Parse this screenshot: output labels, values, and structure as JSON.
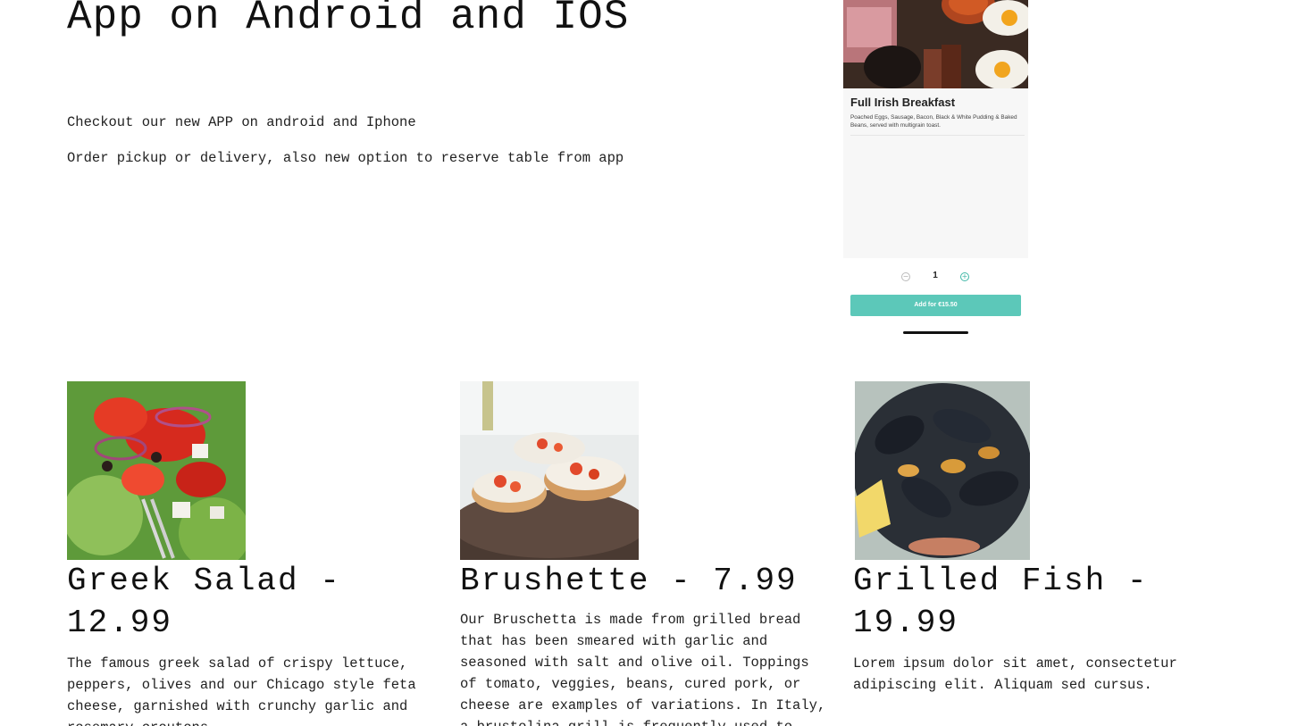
{
  "hero": {
    "title": "App on Android and IOS",
    "line1": "Checkout our new APP on android and Iphone",
    "line2": "Order pickup or delivery, also new option to reserve table from app"
  },
  "phone_app": {
    "item_title": "Full Irish Breakfast",
    "item_description": "Poached Eggs, Sausage, Bacon, Black & White Pudding & Baked Beans, served with multigrain toast.",
    "quantity": "1",
    "minus_symbol": "−",
    "plus_symbol": "+",
    "add_button_label": "Add for €15.50",
    "accent_color": "#5cc8b9"
  },
  "menu": [
    {
      "title": "Greek Salad - 12.99",
      "description": "The famous greek salad of crispy lettuce, peppers, olives and our Chicago style feta cheese, garnished with crunchy garlic and rosemary croutons.",
      "image": "greek-salad-photo"
    },
    {
      "title": "Brushette - 7.99",
      "description": "Our Bruschetta is made from grilled bread that has been smeared with garlic and seasoned with salt and olive oil. Toppings of tomato, veggies, beans, cured pork, or cheese are examples of variations. In Italy, a brustolina grill is frequently used to create bruschetta.",
      "image": "bruschetta-photo"
    },
    {
      "title": "Grilled Fish - 19.99",
      "description": "Lorem ipsum dolor sit amet, consectetur adipiscing elit. Aliquam sed cursus.",
      "image": "mussels-photo"
    }
  ]
}
